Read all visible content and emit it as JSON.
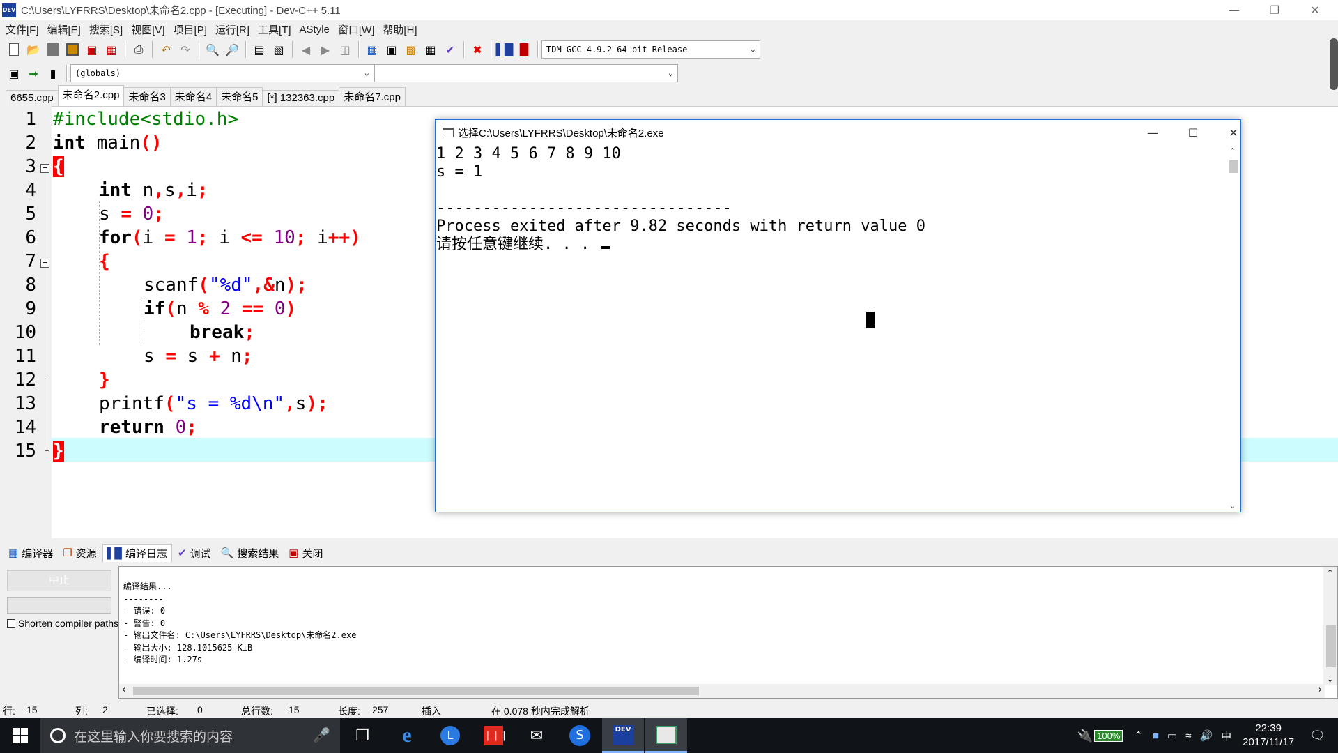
{
  "window": {
    "title": "C:\\Users\\LYFRRS\\Desktop\\未命名2.cpp - [Executing] - Dev-C++ 5.11",
    "icon_label": "DEV",
    "minimize_icon": "minimize-icon",
    "restore_icon": "restore-icon",
    "close_icon": "close-icon"
  },
  "menu": [
    "文件[F]",
    "编辑[E]",
    "搜索[S]",
    "视图[V]",
    "项目[P]",
    "运行[R]",
    "工具[T]",
    "AStyle",
    "窗口[W]",
    "帮助[H]"
  ],
  "toolbar": {
    "compiler_select": "TDM-GCC 4.9.2 64-bit Release",
    "scope_select": "(globals)",
    "function_select": ""
  },
  "tabs": [
    "6655.cpp",
    "未命名2.cpp",
    "未命名3",
    "未命名4",
    "未命名5",
    "[*] 132363.cpp",
    "未命名7.cpp"
  ],
  "active_tab_index": 1,
  "editor": {
    "line_numbers": [
      "1",
      "2",
      "3",
      "4",
      "5",
      "6",
      "7",
      "8",
      "9",
      "10",
      "11",
      "12",
      "13",
      "14",
      "15"
    ],
    "code": {
      "l1": "#include<stdio.h>",
      "l2_kw": "int",
      "l2_rest": " main",
      "l2_sym": "()",
      "l3": "{",
      "l4_kw": "int",
      "l4_rest": " n",
      "l4_c1": ",",
      "l4_s": "s",
      "l4_c2": ",",
      "l4_i": "i",
      "l4_end": ";",
      "l5_a": "s ",
      "l5_eq": "=",
      "l5_num": " 0",
      "l5_end": ";",
      "l6_kw": "for",
      "l6_p1": "(",
      "l6_a": "i ",
      "l6_eq": "=",
      "l6_n1": " 1",
      "l6_s1": ";",
      "l6_b": " i ",
      "l6_le": "<=",
      "l6_n2": " 10",
      "l6_s2": ";",
      "l6_c": " i",
      "l6_pp": "++",
      "l6_p2": ")",
      "l7": "{",
      "l8_a": "scanf",
      "l8_p1": "(",
      "l8_str": "\"%d\"",
      "l8_c": ",",
      "l8_amp": "&",
      "l8_n": "n",
      "l8_p2": ");",
      "l9_kw": "if",
      "l9_p1": "(",
      "l9_a": "n ",
      "l9_mod": "%",
      "l9_n1": " 2 ",
      "l9_eq": "==",
      "l9_n2": " 0",
      "l9_p2": ")",
      "l10_kw": "break",
      "l10_end": ";",
      "l11_a": "s ",
      "l11_eq": "=",
      "l11_b": " s ",
      "l11_plus": "+",
      "l11_c": " n",
      "l11_end": ";",
      "l12": "}",
      "l13_a": "printf",
      "l13_p1": "(",
      "l13_str": "\"s = %d\\n\"",
      "l13_c": ",",
      "l13_s": "s",
      "l13_p2": ");",
      "l14_kw": "return",
      "l14_num": " 0",
      "l14_end": ";",
      "l15": "}"
    }
  },
  "console": {
    "title": "选择C:\\Users\\LYFRRS\\Desktop\\未命名2.exe",
    "lines": [
      "1 2 3 4 5 6 7 8 9 10",
      "s = 1",
      "",
      "--------------------------------",
      "Process exited after 9.82 seconds with return value 0",
      "请按任意键继续. . . "
    ]
  },
  "bottom_tabs": [
    "编译器",
    "资源",
    "编译日志",
    "调试",
    "搜索结果",
    "关闭"
  ],
  "bottom_active_index": 2,
  "compile": {
    "abort_label": "中止",
    "shorten_label": "Shorten compiler paths",
    "shorten_checked": false,
    "log": "编译结果...\n--------\n- 错误: 0\n- 警告: 0\n- 输出文件名: C:\\Users\\LYFRRS\\Desktop\\未命名2.exe\n- 输出大小: 128.1015625 KiB\n- 编译时间: 1.27s"
  },
  "status": {
    "line_label": "行:",
    "line_value": "15",
    "col_label": "列:",
    "col_value": "2",
    "sel_label": "已选择:",
    "sel_value": "0",
    "total_label": "总行数:",
    "total_value": "15",
    "len_label": "长度:",
    "len_value": "257",
    "mode": "插入",
    "parse": "在 0.078 秒内完成解析"
  },
  "taskbar": {
    "search_placeholder": "在这里输入你要搜索的内容",
    "battery": "100%",
    "ime": "中",
    "time": "22:39",
    "date": "2017/11/17"
  }
}
